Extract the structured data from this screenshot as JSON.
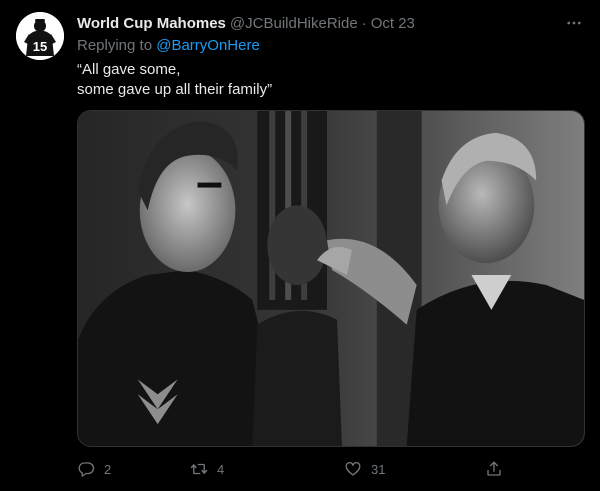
{
  "tweet": {
    "author": {
      "display_name": "World Cup Mahomes",
      "handle": "@JCBuildHikeRide",
      "avatar_icon": "jersey-15-avatar-icon",
      "avatar_number": "15"
    },
    "separator": "·",
    "date": "Oct 23",
    "reply_prefix": "Replying to ",
    "reply_to": "@BarryOnHere",
    "text_lines": [
      "“All gave some,",
      "some gave up all their family”"
    ],
    "media": {
      "kind": "black-and-white photo",
      "icon": "photo-icon"
    },
    "actions": {
      "reply": {
        "icon": "reply-icon",
        "count": "2"
      },
      "retweet": {
        "icon": "retweet-icon",
        "count": "4"
      },
      "like": {
        "icon": "heart-icon",
        "count": "31"
      },
      "share": {
        "icon": "share-icon"
      }
    },
    "more_icon": "more-options-icon"
  },
  "colors": {
    "background": "#000000",
    "primary_text": "#e7e9ea",
    "secondary_text": "#71767b",
    "link": "#1d9bf0",
    "border": "#2f3336"
  }
}
